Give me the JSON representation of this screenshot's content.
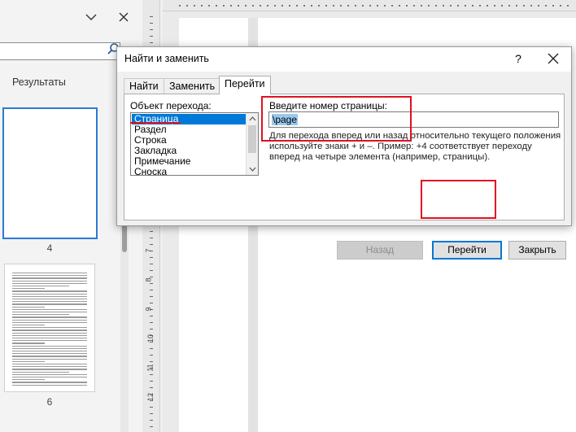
{
  "nav": {
    "results_tab": "Результаты",
    "thumbnails": [
      {
        "page": "4",
        "selected": true
      },
      {
        "page": "6",
        "selected": false
      }
    ]
  },
  "ruler": {
    "vertical_numbers": [
      "7",
      "8",
      "9",
      "10",
      "11",
      "12"
    ]
  },
  "dialog": {
    "title": "Найти и заменить",
    "help": "?",
    "tabs": [
      {
        "label": "Найти",
        "active": false
      },
      {
        "label": "Заменить",
        "active": false
      },
      {
        "label": "Перейти",
        "active": true
      }
    ],
    "goto_target_label": "Объект перехода:",
    "goto_targets": [
      "Страница",
      "Раздел",
      "Строка",
      "Закладка",
      "Примечание",
      "Сноска"
    ],
    "selected_target": "Страница",
    "page_number_label": "Введите номер страницы:",
    "page_number_value": "\\page",
    "hint": "Для перехода вперед или назад относительно текущего положения используйте знаки + и –. Пример: +4 соответствует переходу вперед на четыре элемента (например, страницы).",
    "buttons": {
      "back": "Назад",
      "go": "Перейти",
      "close": "Закрыть"
    }
  },
  "colors": {
    "accent": "#0078d7",
    "annotation": "#e3101e",
    "selection": "#0078d7"
  }
}
